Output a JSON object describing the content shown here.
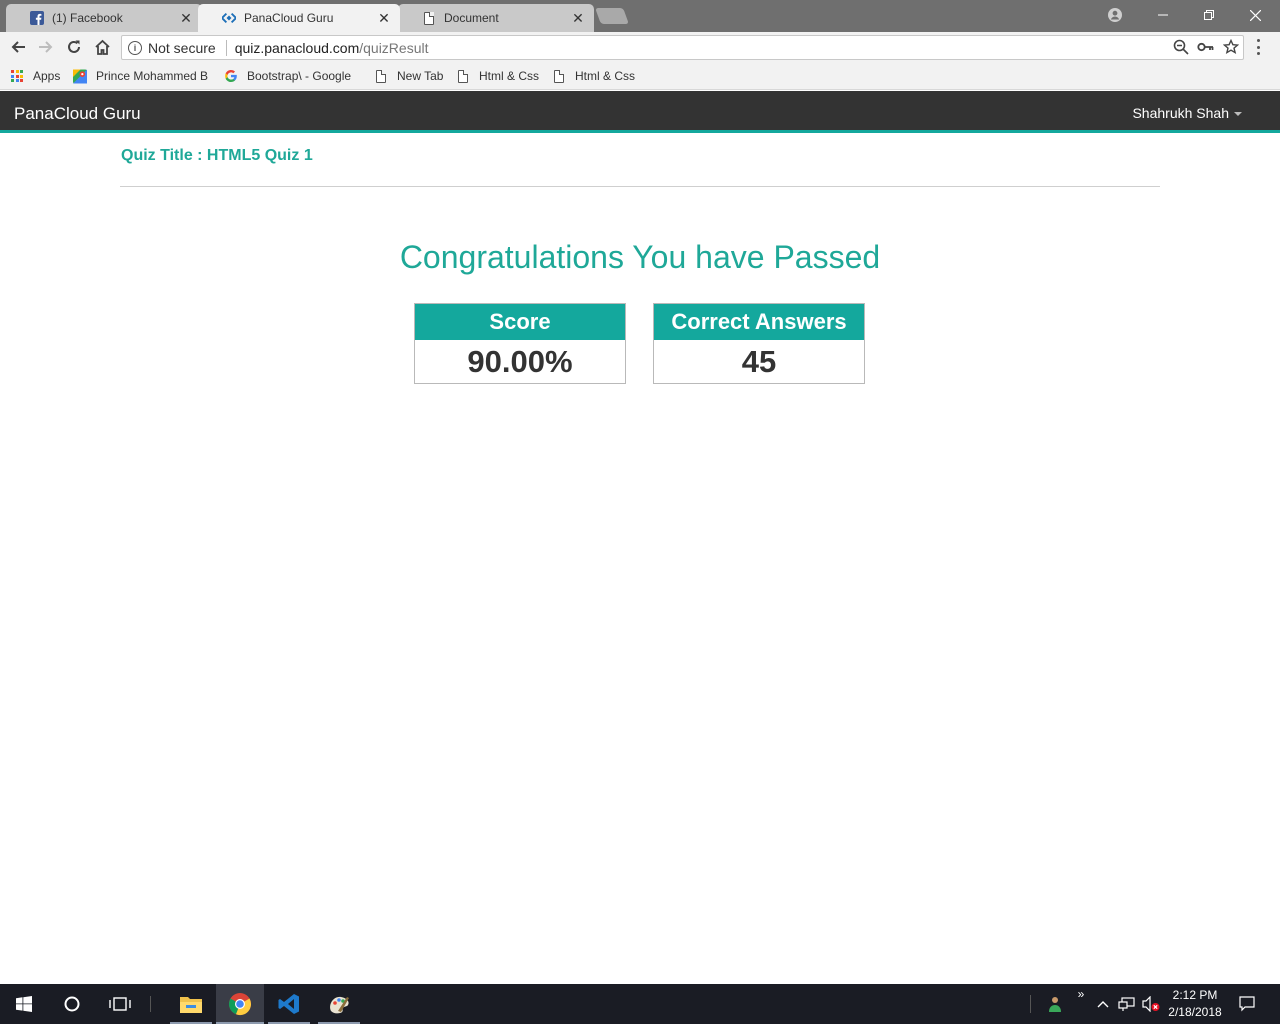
{
  "browser": {
    "tabs": [
      {
        "label": "(1) Facebook",
        "icon": "facebook-icon",
        "active": false
      },
      {
        "label": "PanaCloud Guru",
        "icon": "panacloud-icon",
        "active": true
      },
      {
        "label": "Document",
        "icon": "document-icon",
        "active": false
      }
    ],
    "address": {
      "security": "Not secure",
      "host": "quiz.panacloud.com",
      "path": "/quizResult"
    },
    "bookmarks": [
      {
        "label": "Apps",
        "icon": "apps-grid-icon"
      },
      {
        "label": "Prince Mohammed B",
        "icon": "maps-icon"
      },
      {
        "label": "Bootstrap\\ - Google",
        "icon": "google-icon"
      },
      {
        "label": "New Tab",
        "icon": "page-icon"
      },
      {
        "label": "Html & Css",
        "icon": "page-icon"
      },
      {
        "label": "Html & Css",
        "icon": "page-icon"
      }
    ]
  },
  "app": {
    "brand": "PanaCloud Guru",
    "user": "Shahrukh Shah"
  },
  "result": {
    "quiz_title": "Quiz Title : HTML5 Quiz 1",
    "message": "Congratulations You have Passed",
    "score_label": "Score",
    "score_value": "90.00%",
    "correct_label": "Correct Answers",
    "correct_value": "45"
  },
  "taskbar": {
    "time": "2:12 PM",
    "date": "2/18/2018"
  },
  "colors": {
    "accent": "#14a89d",
    "navbar": "#333333"
  }
}
